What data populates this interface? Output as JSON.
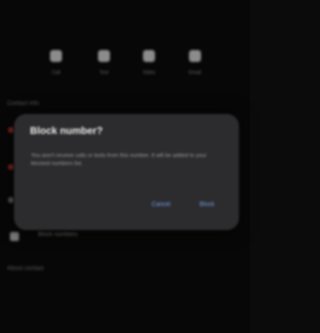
{
  "quick_actions": [
    {
      "icon": "phone-icon",
      "label": "Call"
    },
    {
      "icon": "message-icon",
      "label": "Text"
    },
    {
      "icon": "video-icon",
      "label": "Video"
    },
    {
      "icon": "mail-icon",
      "label": "Email"
    }
  ],
  "contact_section_label": "Contact info",
  "rows": [
    {
      "icon": "block-icon",
      "label": "Block numbers"
    }
  ],
  "footer_section_label": "About contact",
  "dialog": {
    "title": "Block number?",
    "message": "You won't receive calls or texts from this number. It will be added to your blocked numbers list.",
    "cancel_label": "Cancel",
    "confirm_label": "Block"
  },
  "colors": {
    "accent": "#6fa0e8",
    "dialog_bg": "#2c2c2e",
    "dot_red": "#c0392b"
  }
}
